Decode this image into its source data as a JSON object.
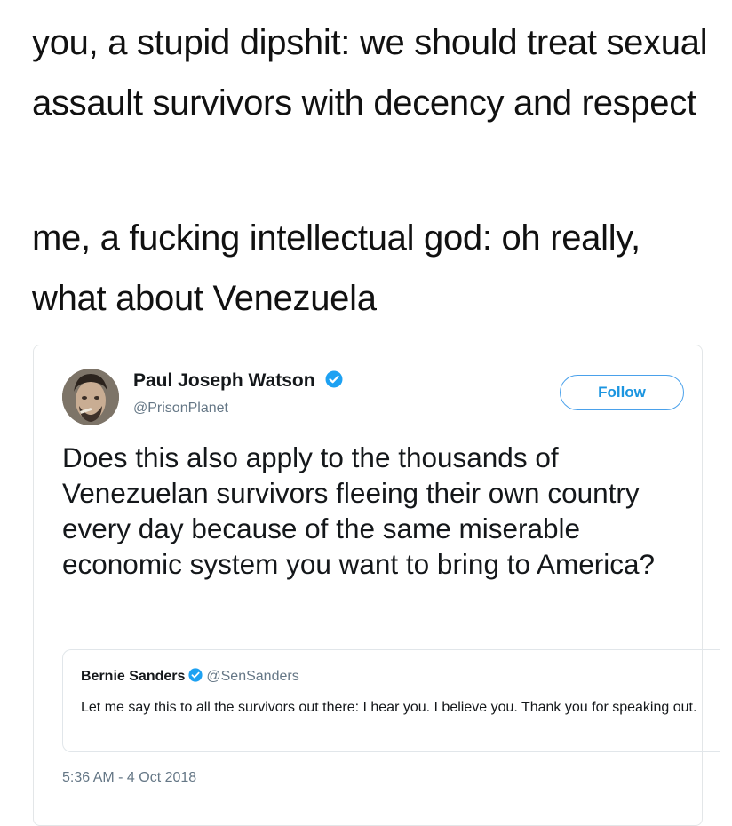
{
  "caption": {
    "line1": "you, a stupid dipshit: we should treat sexual assault survivors with decency and respect",
    "line2": "me, a fucking intellectual god: oh really, what about Venezuela"
  },
  "tweet": {
    "author_name": "Paul Joseph Watson",
    "author_handle": "@PrisonPlanet",
    "follow_label": "Follow",
    "text": "Does this also apply to the thousands of Venezuelan survivors fleeing their own country every day because of the same miserable economic system you want to bring to America?",
    "timestamp": "5:36 AM - 4 Oct 2018"
  },
  "quoted_tweet": {
    "author_name": "Bernie Sanders",
    "author_handle": "@SenSanders",
    "text": "Let me say this to all the survivors out there: I hear you. I believe you. Thank you for speaking out."
  },
  "colors": {
    "verified_blue": "#1da1f2",
    "follow_blue": "#1b95e0",
    "secondary_text": "#657786"
  },
  "icons": {
    "verified": "verified-badge-icon"
  }
}
